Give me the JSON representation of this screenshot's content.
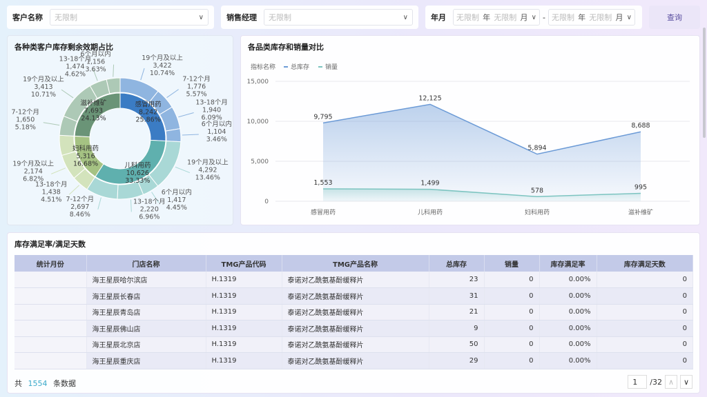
{
  "filters": {
    "customer_label": "客户名称",
    "customer_placeholder": "无限制",
    "manager_label": "销售经理",
    "manager_placeholder": "无限制",
    "date_label": "年月",
    "date_from_year": "无限制",
    "year_unit": "年",
    "date_from_month": "无限制",
    "month_unit": "月",
    "range_sep": "-",
    "date_to_year": "无限制",
    "date_to_month": "无限制",
    "query_button": "查询"
  },
  "donut": {
    "title": "各种类客户库存剩余效期占比",
    "colors": {
      "感冒用药": [
        "#3b7cc4",
        "#8fb5e0"
      ],
      "儿科用药": [
        "#5fb0ae",
        "#a9d8d6"
      ],
      "妇科用药": [
        "#a5c283",
        "#d3e3bc"
      ],
      "滋补维矿": [
        "#6a9477",
        "#adc9b6"
      ]
    },
    "categories": [
      {
        "name": "感冒用药",
        "value": "8,242",
        "pct": "25.86%",
        "v": 8242,
        "segments": [
          {
            "name": "19个月及以上",
            "value": "3,422",
            "pct": "10.74%",
            "v": 3422
          },
          {
            "name": "7-12个月",
            "value": "1,776",
            "pct": "5.57%",
            "v": 1776
          },
          {
            "name": "13-18个月",
            "value": "1,940",
            "pct": "6.09%",
            "v": 1940
          },
          {
            "name": "6个月以内",
            "value": "1,104",
            "pct": "3.46%",
            "v": 1104
          }
        ]
      },
      {
        "name": "儿科用药",
        "value": "10,626",
        "pct": "33.33%",
        "v": 10626,
        "segments": [
          {
            "name": "19个月及以上",
            "value": "4,292",
            "pct": "13.46%",
            "v": 4292
          },
          {
            "name": "6个月以内",
            "value": "1,417",
            "pct": "4.45%",
            "v": 1417
          },
          {
            "name": "13-18个月",
            "value": "2,220",
            "pct": "6.96%",
            "v": 2220
          },
          {
            "name": "7-12个月",
            "value": "2,697",
            "pct": "8.46%",
            "v": 2697
          }
        ]
      },
      {
        "name": "妇科用药",
        "value": "5,316",
        "pct": "16.68%",
        "v": 5316,
        "segments": [
          {
            "name": "13-18个月",
            "value": "1,438",
            "pct": "4.51%",
            "v": 1438
          },
          {
            "name": "19个月及以上",
            "value": "2,174",
            "pct": "6.82%",
            "v": 2174
          }
        ]
      },
      {
        "name": "滋补维矿",
        "value": "7,693",
        "pct": "24.13%",
        "v": 7693,
        "segments": [
          {
            "name": "7-12个月",
            "value": "1,650",
            "pct": "5.18%",
            "v": 1650
          },
          {
            "name": "19个月及以上",
            "value": "3,413",
            "pct": "10.71%",
            "v": 3413
          },
          {
            "name": "13-18个月",
            "value": "1,474",
            "pct": "4.62%",
            "v": 1474
          },
          {
            "name": "6个月以内",
            "value": "1,156",
            "pct": "3.63%",
            "v": 1156
          }
        ]
      }
    ]
  },
  "chart_data": {
    "type": "line",
    "title": "各品类库存和销量对比",
    "legend_title": "指标名称",
    "legend_position": "top-left",
    "categories": [
      "感冒用药",
      "儿科用药",
      "妇科用药",
      "滋补维矿"
    ],
    "ylim": [
      0,
      15000
    ],
    "yticks": [
      "0",
      "5,000",
      "10,000",
      "15,000"
    ],
    "grid": true,
    "series": [
      {
        "name": "总库存",
        "color": "#6b9ad6",
        "values": [
          9795,
          12125,
          5894,
          8688
        ],
        "labels": [
          "9,795",
          "12,125",
          "5,894",
          "8,688"
        ]
      },
      {
        "name": "销量",
        "color": "#7cc4c0",
        "values": [
          1553,
          1499,
          578,
          995
        ],
        "labels": [
          "1,553",
          "1,499",
          "578",
          "995"
        ]
      }
    ]
  },
  "table": {
    "title": "库存满足率/满足天数",
    "columns": [
      "统计月份",
      "门店名称",
      "TMG产品代码",
      "TMG产品名称",
      "总库存",
      "销量",
      "库存满足率",
      "库存满足天数"
    ],
    "rows": [
      [
        "",
        "海王星辰哈尔滨店",
        "H.1319",
        "泰诺对乙酰氨基酚缓释片",
        "23",
        "0",
        "0.00%",
        "0"
      ],
      [
        "",
        "海王星辰长春店",
        "H.1319",
        "泰诺对乙酰氨基酚缓释片",
        "31",
        "0",
        "0.00%",
        "0"
      ],
      [
        "",
        "海王星辰青岛店",
        "H.1319",
        "泰诺对乙酰氨基酚缓释片",
        "21",
        "0",
        "0.00%",
        "0"
      ],
      [
        "",
        "海王星辰佛山店",
        "H.1319",
        "泰诺对乙酰氨基酚缓释片",
        "9",
        "0",
        "0.00%",
        "0"
      ],
      [
        "",
        "海王星辰北京店",
        "H.1319",
        "泰诺对乙酰氨基酚缓释片",
        "50",
        "0",
        "0.00%",
        "0"
      ],
      [
        "",
        "海王星辰重庆店",
        "H.1319",
        "泰诺对乙酰氨基酚缓释片",
        "29",
        "0",
        "0.00%",
        "0"
      ]
    ]
  },
  "pager": {
    "prefix": "共",
    "total": "1554",
    "suffix": "条数据",
    "page": "1",
    "pages": "/32"
  }
}
